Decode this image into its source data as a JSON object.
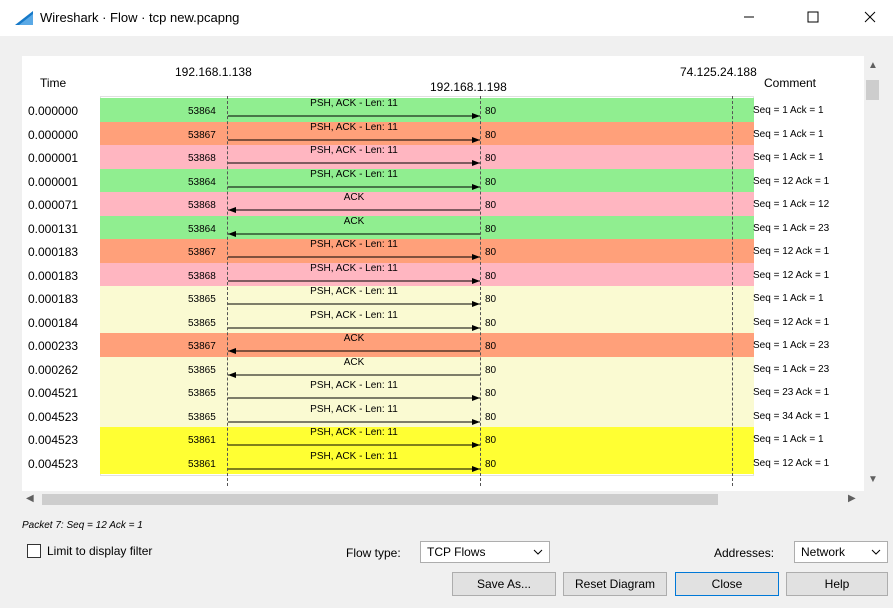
{
  "window": {
    "title": "Wireshark · Flow · tcp new.pcapng"
  },
  "header": {
    "time_label": "Time",
    "comment_label": "Comment",
    "hosts": [
      "192.168.1.138",
      "192.168.1.198",
      "74.125.24.188"
    ]
  },
  "rows": [
    {
      "time": "0.000000",
      "port": "53864",
      "label": "PSH, ACK - Len: 11",
      "dst_port": "80",
      "direction": "right",
      "color": "#90ee90",
      "comment": "Seq = 1 Ack = 1"
    },
    {
      "time": "0.000000",
      "port": "53867",
      "label": "PSH, ACK - Len: 11",
      "dst_port": "80",
      "direction": "right",
      "color": "#ffa07a",
      "comment": "Seq = 1 Ack = 1"
    },
    {
      "time": "0.000001",
      "port": "53868",
      "label": "PSH, ACK - Len: 11",
      "dst_port": "80",
      "direction": "right",
      "color": "#ffb6c1",
      "comment": "Seq = 1 Ack = 1"
    },
    {
      "time": "0.000001",
      "port": "53864",
      "label": "PSH, ACK - Len: 11",
      "dst_port": "80",
      "direction": "right",
      "color": "#90ee90",
      "comment": "Seq = 12 Ack = 1"
    },
    {
      "time": "0.000071",
      "port": "53868",
      "label": "ACK",
      "dst_port": "80",
      "direction": "left",
      "color": "#ffb6c1",
      "comment": "Seq = 1 Ack = 12"
    },
    {
      "time": "0.000131",
      "port": "53864",
      "label": "ACK",
      "dst_port": "80",
      "direction": "left",
      "color": "#90ee90",
      "comment": "Seq = 1 Ack = 23"
    },
    {
      "time": "0.000183",
      "port": "53867",
      "label": "PSH, ACK - Len: 11",
      "dst_port": "80",
      "direction": "right",
      "color": "#ffa07a",
      "comment": "Seq = 12 Ack = 1"
    },
    {
      "time": "0.000183",
      "port": "53868",
      "label": "PSH, ACK - Len: 11",
      "dst_port": "80",
      "direction": "right",
      "color": "#ffb6c1",
      "comment": "Seq = 12 Ack = 1"
    },
    {
      "time": "0.000183",
      "port": "53865",
      "label": "PSH, ACK - Len: 11",
      "dst_port": "80",
      "direction": "right",
      "color": "#fafad2",
      "comment": "Seq = 1 Ack = 1"
    },
    {
      "time": "0.000184",
      "port": "53865",
      "label": "PSH, ACK - Len: 11",
      "dst_port": "80",
      "direction": "right",
      "color": "#fafad2",
      "comment": "Seq = 12 Ack = 1"
    },
    {
      "time": "0.000233",
      "port": "53867",
      "label": "ACK",
      "dst_port": "80",
      "direction": "left",
      "color": "#ffa07a",
      "comment": "Seq = 1 Ack = 23"
    },
    {
      "time": "0.000262",
      "port": "53865",
      "label": "ACK",
      "dst_port": "80",
      "direction": "left",
      "color": "#fafad2",
      "comment": "Seq = 1 Ack = 23"
    },
    {
      "time": "0.004521",
      "port": "53865",
      "label": "PSH, ACK - Len: 11",
      "dst_port": "80",
      "direction": "right",
      "color": "#fafad2",
      "comment": "Seq = 23 Ack = 1"
    },
    {
      "time": "0.004523",
      "port": "53865",
      "label": "PSH, ACK - Len: 11",
      "dst_port": "80",
      "direction": "right",
      "color": "#fafad2",
      "comment": "Seq = 34 Ack = 1"
    },
    {
      "time": "0.004523",
      "port": "53861",
      "label": "PSH, ACK - Len: 11",
      "dst_port": "80",
      "direction": "right",
      "color": "#ffff33",
      "comment": "Seq = 1 Ack = 1"
    },
    {
      "time": "0.004523",
      "port": "53861",
      "label": "PSH, ACK - Len: 11",
      "dst_port": "80",
      "direction": "right",
      "color": "#ffff33",
      "comment": "Seq = 12 Ack = 1"
    }
  ],
  "footer": {
    "packet_info": "Packet 7: Seq = 12 Ack = 1",
    "limit_label": "Limit to display filter",
    "limit_checked": false,
    "flow_type_label": "Flow type:",
    "flow_type_value": "TCP Flows",
    "addresses_label": "Addresses:",
    "addresses_value": "Network",
    "save_as": "Save As...",
    "reset": "Reset Diagram",
    "close": "Close",
    "help": "Help"
  },
  "icons": {
    "app": "wireshark-fin-icon",
    "minimize": "minimize-icon",
    "maximize": "maximize-icon",
    "close": "close-icon"
  },
  "colors": {
    "green": "#90ee90",
    "salmon": "#ffa07a",
    "pink": "#ffb6c1",
    "cream": "#fafad2",
    "yellow": "#ffff33",
    "focus_border": "#0078d7"
  }
}
